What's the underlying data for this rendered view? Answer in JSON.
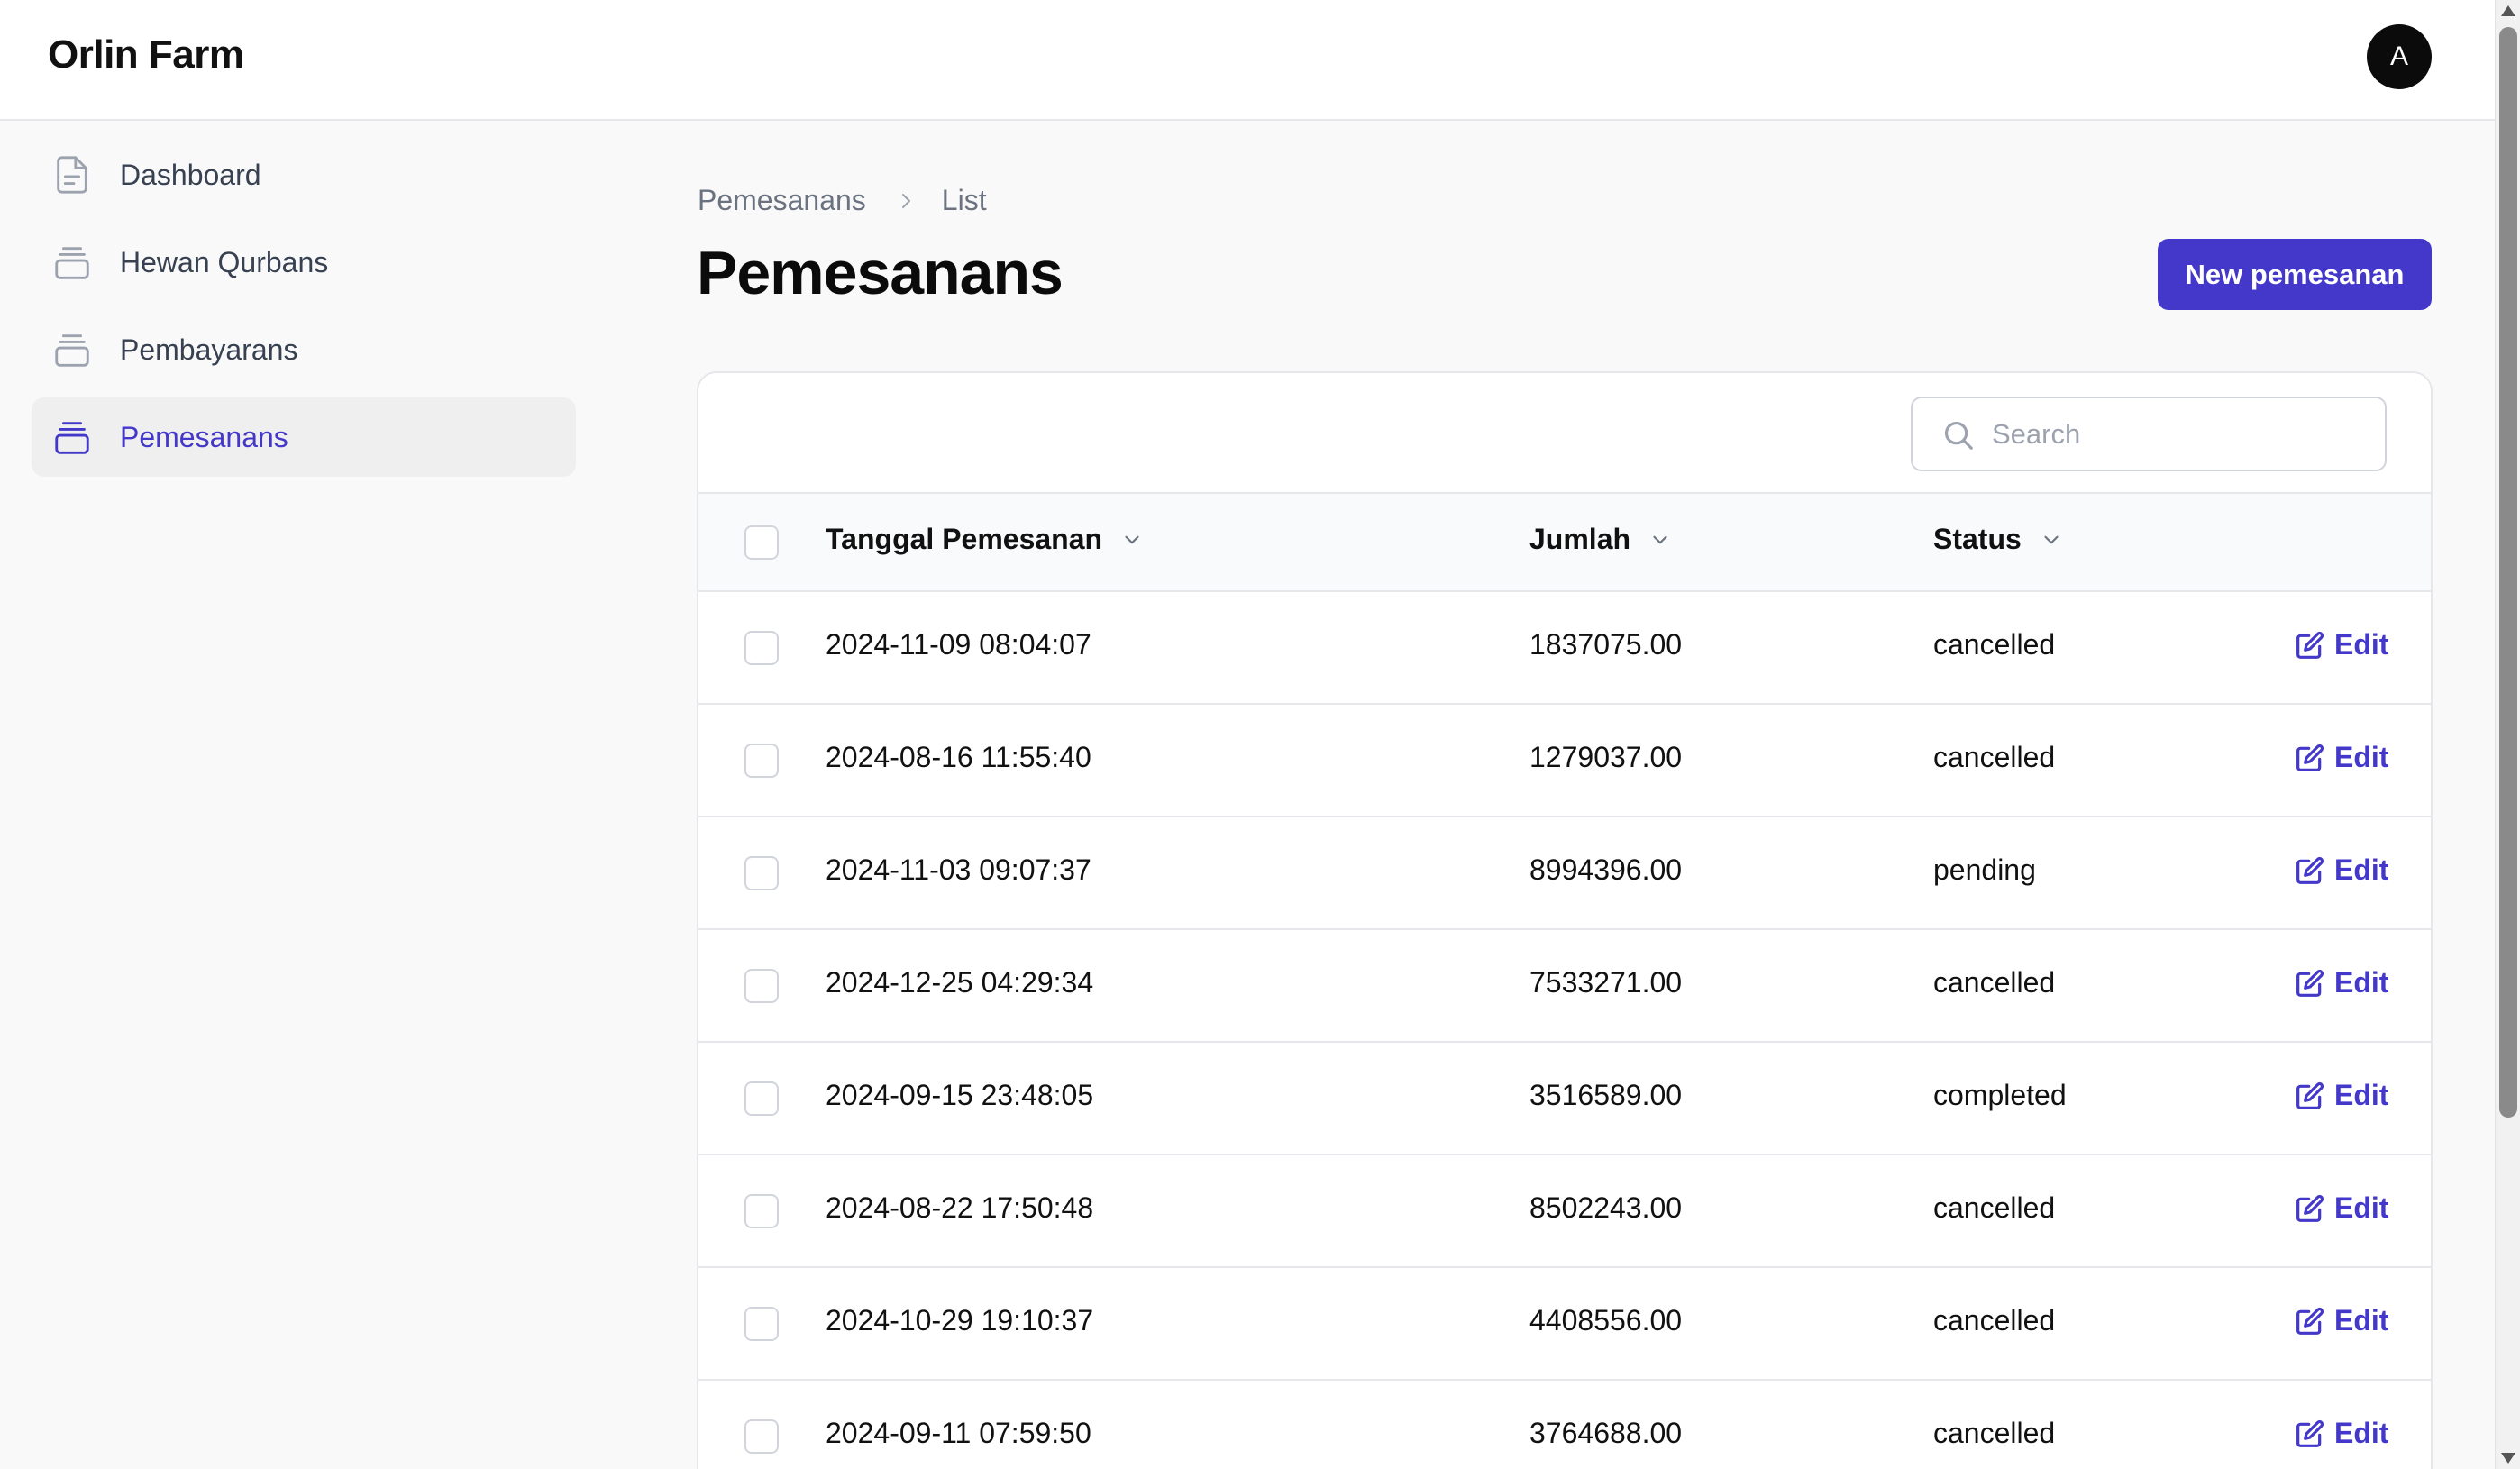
{
  "app": {
    "brand": "Orlin Farm",
    "avatar_initial": "A"
  },
  "sidebar": {
    "items": [
      {
        "label": "Dashboard",
        "icon": "document-icon",
        "active": false
      },
      {
        "label": "Hewan Qurbans",
        "icon": "collection-icon",
        "active": false
      },
      {
        "label": "Pembayarans",
        "icon": "collection-icon",
        "active": false
      },
      {
        "label": "Pemesanans",
        "icon": "collection-icon",
        "active": true
      }
    ]
  },
  "breadcrumb": {
    "parent": "Pemesanans",
    "current": "List"
  },
  "page": {
    "title": "Pemesanans",
    "new_button": "New pemesanan"
  },
  "search": {
    "placeholder": "Search",
    "value": ""
  },
  "table": {
    "headers": {
      "date": "Tanggal Pemesanan",
      "amount": "Jumlah",
      "status": "Status"
    },
    "edit_label": "Edit",
    "rows": [
      {
        "date": "2024-11-09 08:04:07",
        "amount": "1837075.00",
        "status": "cancelled"
      },
      {
        "date": "2024-08-16 11:55:40",
        "amount": "1279037.00",
        "status": "cancelled"
      },
      {
        "date": "2024-11-03 09:07:37",
        "amount": "8994396.00",
        "status": "pending"
      },
      {
        "date": "2024-12-25 04:29:34",
        "amount": "7533271.00",
        "status": "cancelled"
      },
      {
        "date": "2024-09-15 23:48:05",
        "amount": "3516589.00",
        "status": "completed"
      },
      {
        "date": "2024-08-22 17:50:48",
        "amount": "8502243.00",
        "status": "cancelled"
      },
      {
        "date": "2024-10-29 19:10:37",
        "amount": "4408556.00",
        "status": "cancelled"
      },
      {
        "date": "2024-09-11 07:59:50",
        "amount": "3764688.00",
        "status": "cancelled"
      }
    ]
  },
  "colors": {
    "accent": "#4338ca",
    "background": "#f9f9f9",
    "border": "#e5e7eb"
  }
}
